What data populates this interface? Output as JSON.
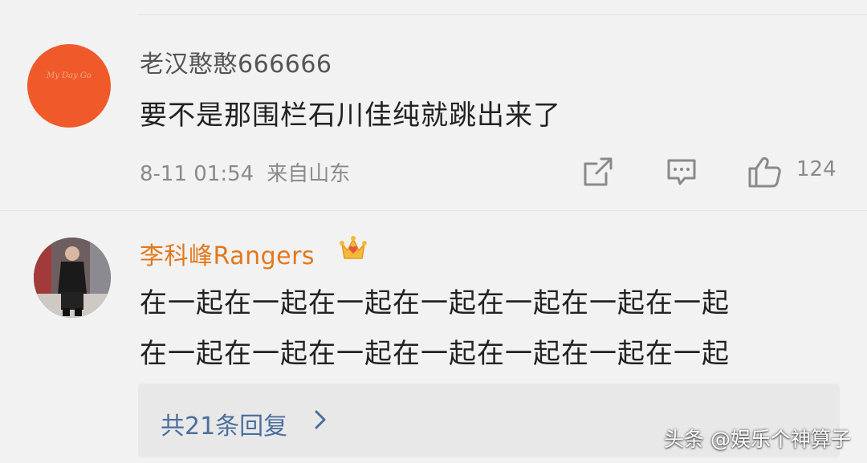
{
  "comments": [
    {
      "username": "老汉憨憨666666",
      "avatar_text": "My Day Go",
      "text": "要不是那围栏石川佳纯就跳出来了",
      "date": "8-11 01:54",
      "location": "来自山东",
      "likes": "124"
    },
    {
      "username": "李科峰Rangers",
      "badge": "crown-icon",
      "text_lines": [
        "在一起在一起在一起在一起在一起在一起在一起",
        "在一起在一起在一起在一起在一起在一起在一起"
      ],
      "replies_label": "共21条回复"
    }
  ],
  "watermark": "头条 @娱乐个神算子",
  "colors": {
    "background": "#f2f2f2",
    "username_vip": "#e3781c",
    "reply_link": "#4a6f9e",
    "avatar_orange": "#f05a2a"
  }
}
